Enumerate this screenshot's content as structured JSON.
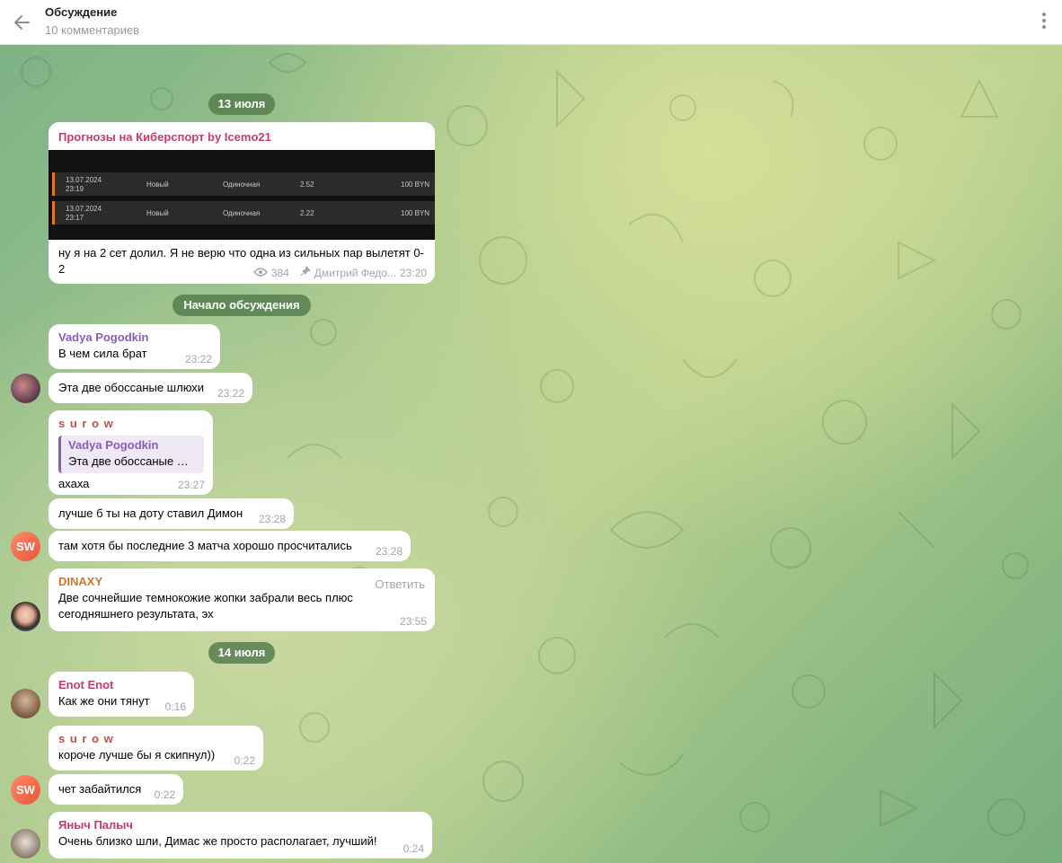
{
  "header": {
    "title": "Обсуждение",
    "subtitle": "10 комментариев"
  },
  "dates": {
    "first": "13 июля",
    "discussion_start": "Начало обсуждения",
    "second": "14 июля"
  },
  "channel_post": {
    "channel_name": "Прогнозы на Киберспорт by Icemo21",
    "bets": [
      {
        "date": "13.07.2024",
        "time": "23:19",
        "status": "Новый",
        "type": "Одиночная",
        "odds": "2.52",
        "amount": "100 BYN"
      },
      {
        "date": "13.07.2024",
        "time": "23:17",
        "status": "Новый",
        "type": "Одиночная",
        "odds": "2.22",
        "amount": "100 BYN"
      }
    ],
    "text": "ну я на 2 сет долил. Я не верю что одна из сильных пар вылетят 0-2",
    "views": "384",
    "author": "Дмитрий Федо...",
    "time": "23:20"
  },
  "messages": [
    {
      "author": "Vadya Pogodkin",
      "text": "В чем сила брат",
      "time": "23:22",
      "author_color": "#8a5bc2"
    },
    {
      "text": "Эта две обоссаные шлюхи",
      "time": "23:22"
    },
    {
      "author": "s u r o w",
      "text": "ахаха",
      "time": "23:27",
      "author_color": "#c0504d",
      "reply": {
        "name": "Vadya Pogodkin",
        "text": "Эта две обоссаные шлюхи"
      }
    },
    {
      "text": "лучше б ты на доту ставил Димон",
      "time": "23:28"
    },
    {
      "text": "там хотя бы последние 3 матча хорошо просчитались",
      "time": "23:28",
      "avatar": "SW"
    },
    {
      "author": "DINAXY",
      "text": "Две сочнейшие темнокожие жопки забрали весь плюс сегодняшнего результата, эх",
      "time": "23:55",
      "author_color": "#d4742c",
      "reply_label": "Ответить"
    },
    {
      "author": "Enot Enot",
      "text": "Как же они тянут",
      "time": "0:16",
      "author_color": "#c43b6f"
    },
    {
      "author": "s u r o w",
      "text": "короче лучше бы я скипнул))",
      "time": "0:22",
      "author_color": "#c0504d"
    },
    {
      "text": "чет забайтился",
      "time": "0:22",
      "avatar": "SW"
    },
    {
      "author": "Яныч Палыч",
      "text": "Очень близко шли, Димас же просто располагает, лучший!",
      "time": "0:24",
      "author_color": "#c43b6f"
    }
  ]
}
